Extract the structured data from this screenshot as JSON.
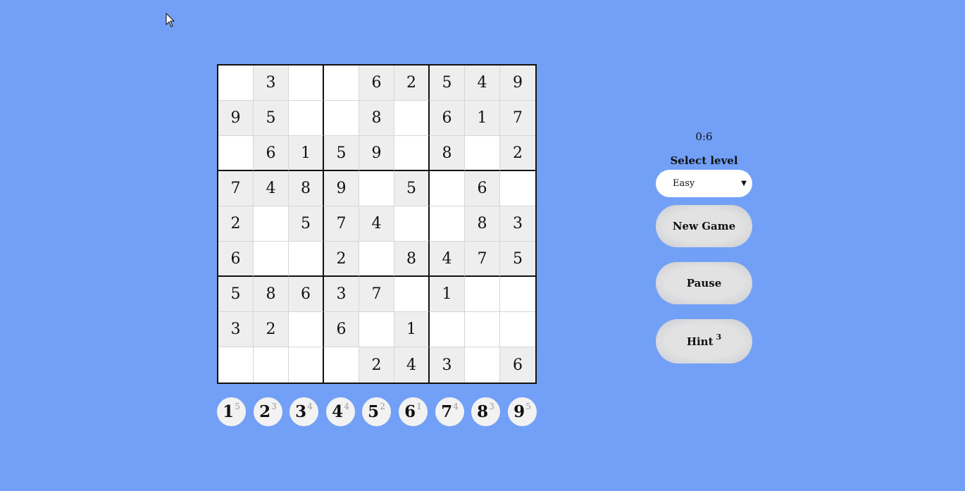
{
  "board": [
    [
      "",
      "3",
      "",
      "",
      "6",
      "2",
      "5",
      "4",
      "9"
    ],
    [
      "9",
      "5",
      "",
      "",
      "8",
      "",
      "6",
      "1",
      "7"
    ],
    [
      "",
      "6",
      "1",
      "5",
      "9",
      "",
      "8",
      "",
      "2"
    ],
    [
      "7",
      "4",
      "8",
      "9",
      "",
      "5",
      "",
      "6",
      ""
    ],
    [
      "2",
      "",
      "5",
      "7",
      "4",
      "",
      "",
      "8",
      "3"
    ],
    [
      "6",
      "",
      "",
      "2",
      "",
      "8",
      "4",
      "7",
      "5"
    ],
    [
      "5",
      "8",
      "6",
      "3",
      "7",
      "",
      "1",
      "",
      ""
    ],
    [
      "3",
      "2",
      "",
      "6",
      "",
      "1",
      "",
      "",
      ""
    ],
    [
      "",
      "",
      "",
      "",
      "2",
      "4",
      "3",
      "",
      "6"
    ]
  ],
  "numpad": [
    {
      "digit": "1",
      "count": "5"
    },
    {
      "digit": "2",
      "count": "3"
    },
    {
      "digit": "3",
      "count": "4"
    },
    {
      "digit": "4",
      "count": "4"
    },
    {
      "digit": "5",
      "count": "2"
    },
    {
      "digit": "6",
      "count": "1"
    },
    {
      "digit": "7",
      "count": "4"
    },
    {
      "digit": "8",
      "count": "3"
    },
    {
      "digit": "9",
      "count": "5"
    }
  ],
  "controls": {
    "timer": "0:6",
    "level_label": "Select level",
    "level_value": "Easy",
    "new_game_label": "New Game",
    "pause_label": "Pause",
    "hint_label": "Hint",
    "hint_count": "3"
  },
  "icons": {
    "cursor": "mouse-pointer-icon",
    "level_caret": "caret-down-icon"
  },
  "colors": {
    "background": "#72a0f6",
    "given_cell": "#eeeeee",
    "empty_cell": "#ffffff"
  }
}
